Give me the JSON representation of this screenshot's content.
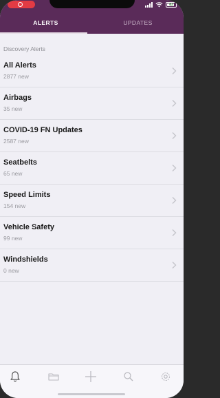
{
  "colors": {
    "header": "#5a2b59",
    "background": "#f0eff5"
  },
  "status_bar": {
    "battery_label": "83"
  },
  "tabs": [
    {
      "label": "ALERTS",
      "selected": true
    },
    {
      "label": "UPDATES",
      "selected": false
    }
  ],
  "section_header": "Discovery Alerts",
  "alerts": [
    {
      "title": "All Alerts",
      "subtitle": "2877 new"
    },
    {
      "title": "Airbags",
      "subtitle": "35 new"
    },
    {
      "title": "COVID-19 FN Updates",
      "subtitle": "2587 new"
    },
    {
      "title": "Seatbelts",
      "subtitle": "65 new"
    },
    {
      "title": "Speed Limits",
      "subtitle": "154 new"
    },
    {
      "title": "Vehicle Safety",
      "subtitle": "99 new"
    },
    {
      "title": "Windshields",
      "subtitle": "0 new"
    }
  ],
  "bottom_nav": [
    {
      "icon": "bell-icon",
      "active": true
    },
    {
      "icon": "folder-icon",
      "active": false
    },
    {
      "icon": "plus-icon",
      "active": false
    },
    {
      "icon": "search-icon",
      "active": false
    },
    {
      "icon": "gear-icon",
      "active": false
    }
  ]
}
